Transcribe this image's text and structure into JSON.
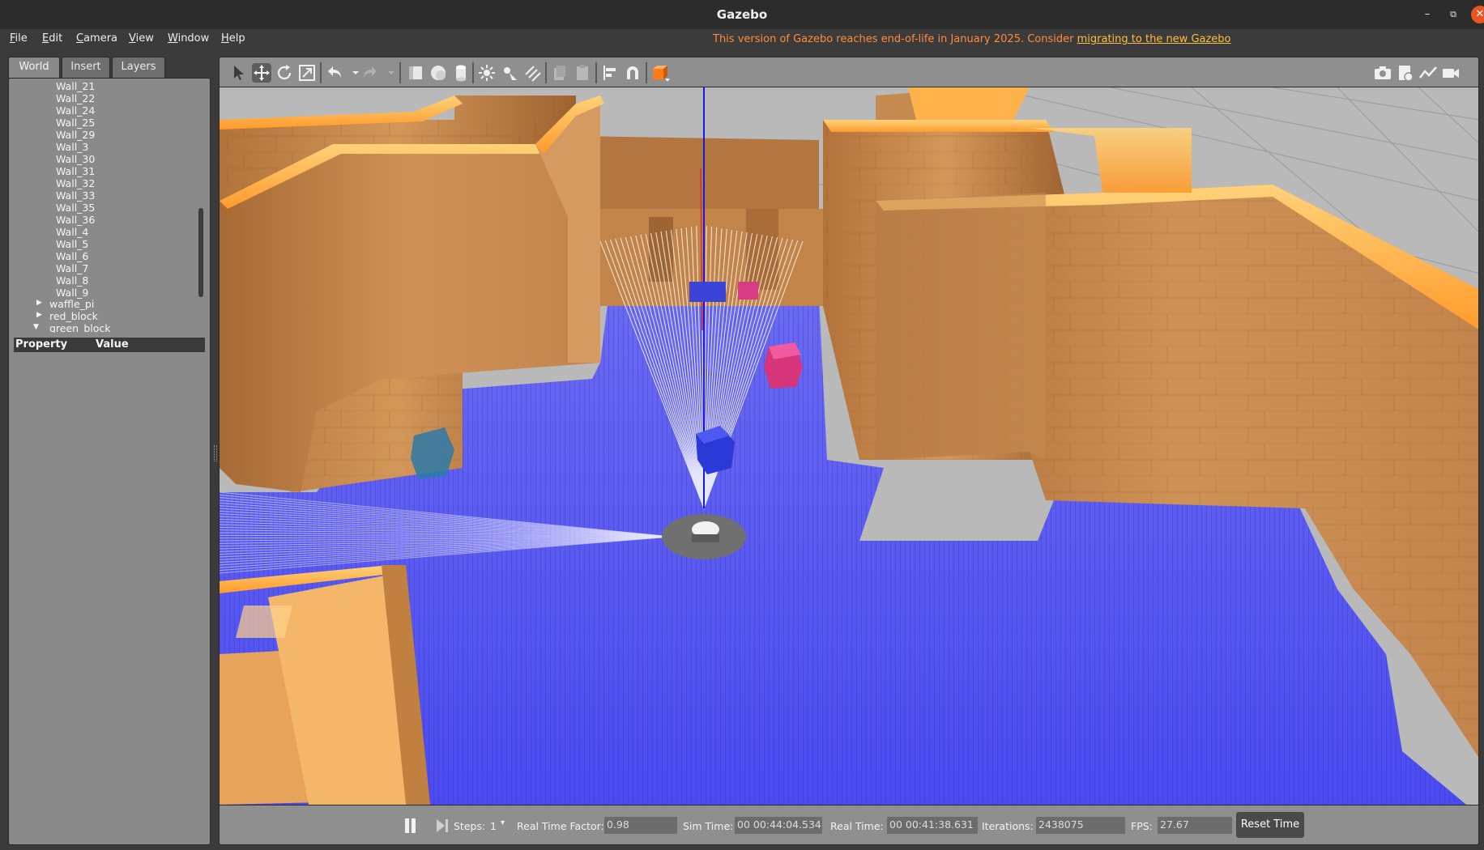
{
  "window": {
    "title": "Gazebo"
  },
  "menu": {
    "items": [
      {
        "label": "File",
        "u": "F",
        "rest": "ile"
      },
      {
        "label": "Edit",
        "u": "E",
        "rest": "dit"
      },
      {
        "label": "Camera",
        "u": "C",
        "rest": "amera"
      },
      {
        "label": "View",
        "u": "V",
        "rest": "iew"
      },
      {
        "label": "Window",
        "u": "W",
        "rest": "indow"
      },
      {
        "label": "Help",
        "u": "H",
        "rest": "elp"
      }
    ],
    "eol_notice": "This version of Gazebo reaches end-of-life in January 2025. Consider ",
    "eol_link": "migrating to the new Gazebo"
  },
  "left_panel": {
    "tabs": [
      "World",
      "Insert",
      "Layers"
    ],
    "walls": [
      "Wall_21",
      "Wall_22",
      "Wall_24",
      "Wall_25",
      "Wall_29",
      "Wall_3",
      "Wall_30",
      "Wall_31",
      "Wall_32",
      "Wall_33",
      "Wall_35",
      "Wall_36",
      "Wall_4",
      "Wall_5",
      "Wall_6",
      "Wall_7",
      "Wall_8",
      "Wall_9"
    ],
    "models": [
      {
        "label": "waffle_pi",
        "expanded": false
      },
      {
        "label": "red_block",
        "expanded": false
      },
      {
        "label": "green_block",
        "expanded": true
      }
    ],
    "property_header": "Property",
    "value_header": "Value"
  },
  "toolbar": {
    "tools": [
      "select-arrow-icon",
      "translate-icon",
      "rotate-icon",
      "scale-icon",
      "undo-icon",
      "redo-icon",
      "box-icon",
      "sphere-icon",
      "cylinder-icon",
      "point-light-icon",
      "spot-light-icon",
      "directional-light-icon",
      "copy-icon",
      "paste-icon",
      "align-icon",
      "snap-icon",
      "view-angle-icon"
    ],
    "right_tools": [
      "screenshot-icon",
      "log-icon",
      "plot-icon",
      "record-video-icon"
    ]
  },
  "bottom_bar": {
    "steps_label": "Steps:",
    "steps_value": "1",
    "rtf_label": "Real Time Factor:",
    "rtf_value": "0.98",
    "sim_time_label": "Sim Time:",
    "sim_time_value": "00 00:44:04.534",
    "real_time_label": "Real Time:",
    "real_time_value": "00 00:41:38.631",
    "iterations_label": "Iterations:",
    "iterations_value": "2438075",
    "fps_label": "FPS:",
    "fps_value": "27.67",
    "reset_label": "Reset Time"
  },
  "colors": {
    "wall": "#c8894a",
    "wall_top": "#ffb24a",
    "laser_floor": "#5a5af0",
    "accent": "#e95420"
  }
}
